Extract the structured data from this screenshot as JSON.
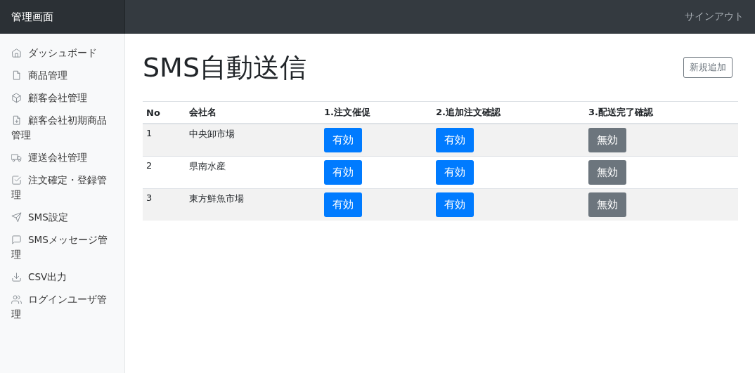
{
  "brand": "管理画面",
  "signout": "サインアウト",
  "sidebar": {
    "items": [
      {
        "label": "ダッシュボード",
        "kind": "home"
      },
      {
        "label": "商品管理",
        "kind": "file"
      },
      {
        "label": "顧客会社管理",
        "kind": "box"
      },
      {
        "label": "顧客会社初期商品管理",
        "kind": "file-plus"
      },
      {
        "label": "運送会社管理",
        "kind": "truck"
      },
      {
        "label": "注文確定・登録管理",
        "kind": "check"
      },
      {
        "label": "SMS設定",
        "kind": "send"
      },
      {
        "label": "SMSメッセージ管理",
        "kind": "message"
      },
      {
        "label": "CSV出力",
        "kind": "download"
      },
      {
        "label": "ログインユーザ管理",
        "kind": "users"
      }
    ]
  },
  "page": {
    "title": "SMS自動送信",
    "add_button": "新規追加"
  },
  "table": {
    "columns": [
      "No",
      "会社名",
      "1.注文催促",
      "2.追加注文確認",
      "3.配送完了確認"
    ],
    "rows": [
      {
        "no": "1",
        "company": "中央卸市場",
        "toggles": [
          {
            "label": "有効",
            "enabled": true
          },
          {
            "label": "有効",
            "enabled": true
          },
          {
            "label": "無効",
            "enabled": false
          }
        ]
      },
      {
        "no": "2",
        "company": "県南水産",
        "toggles": [
          {
            "label": "有効",
            "enabled": true
          },
          {
            "label": "有効",
            "enabled": true
          },
          {
            "label": "無効",
            "enabled": false
          }
        ]
      },
      {
        "no": "3",
        "company": "東方鮮魚市場",
        "toggles": [
          {
            "label": "有効",
            "enabled": true
          },
          {
            "label": "有効",
            "enabled": true
          },
          {
            "label": "無効",
            "enabled": false
          }
        ]
      }
    ]
  }
}
